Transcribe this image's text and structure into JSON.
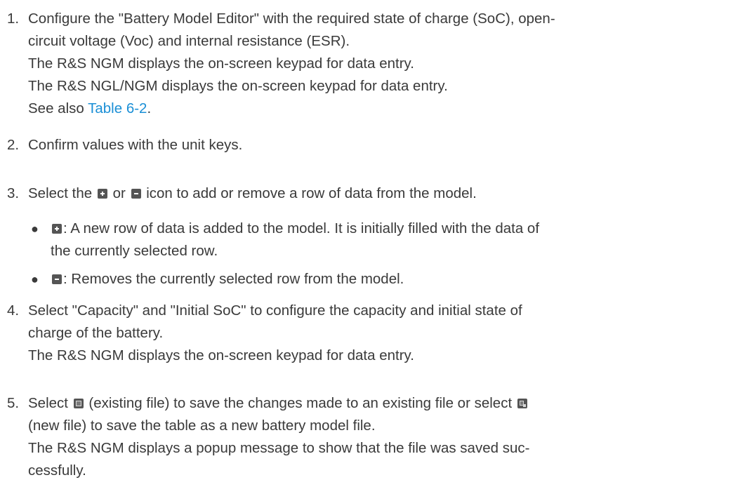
{
  "steps": [
    {
      "number": "1.",
      "lines": [
        "Configure the \"Battery Model Editor\" with the required state of charge (SoC), open-",
        "circuit voltage (Voc) and internal resistance (ESR).",
        "The R&S NGM displays the on-screen keypad for data entry.",
        "The R&S NGL/NGM displays the on-screen keypad for data entry."
      ],
      "see_also_prefix": "See also ",
      "see_also_link": "Table 6-2",
      "see_also_suffix": "."
    },
    {
      "number": "2.",
      "text": "Confirm values with the unit keys."
    },
    {
      "number": "3.",
      "text_before": "Select the ",
      "text_middle": " or ",
      "text_after": " icon to add or remove a row of data from the model.",
      "bullets": [
        {
          "icon": "plus-icon",
          "lines": [
            ": A new row of data is added to the model. It is initially filled with the data of",
            "the currently selected row."
          ]
        },
        {
          "icon": "minus-icon",
          "lines": [
            ": Removes the currently selected row from the model."
          ]
        }
      ]
    },
    {
      "number": "4.",
      "lines": [
        "Select \"Capacity\" and \"Initial SoC\" to configure the capacity and initial state of",
        "charge of the battery.",
        "The R&S NGM displays the on-screen keypad for data entry."
      ]
    },
    {
      "number": "5.",
      "line1_before": "Select ",
      "line1_middle": " (existing file) to save the changes made to an existing file or select ",
      "line2": "(new file) to save the table as a new battery model file.",
      "line3": "The R&S NGM displays a popup message to show that the file was saved suc-",
      "line4": "cessfully."
    }
  ],
  "colors": {
    "text": "#3a3a3a",
    "link": "#1a8fd6",
    "icon": "#555555"
  }
}
